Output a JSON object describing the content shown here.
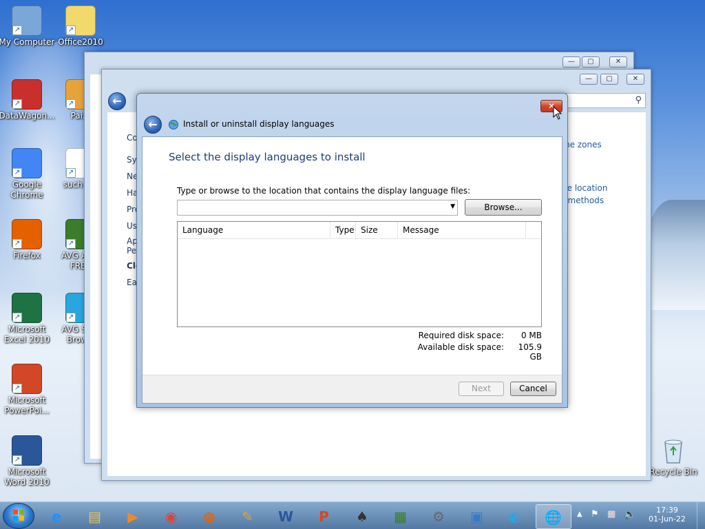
{
  "desktop": {
    "icons_col1": [
      {
        "label": "My Computer",
        "icon": "computer-icon",
        "color": "#7aa7d8"
      },
      {
        "label": "DataWagon...",
        "icon": "datawagon-icon",
        "color": "#c9302c"
      },
      {
        "label": "Google Chrome",
        "icon": "chrome-icon",
        "color": "#4285f4"
      },
      {
        "label": "Firefox",
        "icon": "firefox-icon",
        "color": "#e66000"
      },
      {
        "label": "Microsoft Excel 2010",
        "icon": "excel-icon",
        "color": "#1f7244"
      },
      {
        "label": "Microsoft PowerPoi...",
        "icon": "powerpoint-icon",
        "color": "#d24726"
      },
      {
        "label": "Microsoft Word 2010",
        "icon": "word-icon",
        "color": "#2b579a"
      }
    ],
    "icons_col2": [
      {
        "label": "Office2010",
        "icon": "iso-file-icon",
        "color": "#f2d96b"
      },
      {
        "label": "Pai...",
        "icon": "paint-icon",
        "color": "#e8a23a"
      },
      {
        "label": "such a...",
        "icon": "document-icon",
        "color": "#ffffff"
      },
      {
        "label": "AVG An... FREE",
        "icon": "avg-antivirus-icon",
        "color": "#3a7d2c"
      },
      {
        "label": "AVG Se... Brow...",
        "icon": "avg-browser-icon",
        "color": "#2aa6de"
      }
    ],
    "recycle_bin": {
      "label": "Recycle Bin",
      "icon": "recycle-bin-icon"
    }
  },
  "background_window": {
    "left_items": [
      "Co",
      "Sys",
      "Ne",
      "Ha",
      "Pro",
      "Us",
      "Ap",
      "Pe",
      "Clo",
      "Eas"
    ],
    "links": [
      "me zones",
      "ge location",
      "t methods"
    ]
  },
  "dialog": {
    "title": "Install or uninstall display languages",
    "heading": "Select the display languages to install",
    "path_label": "Type or browse to the location that contains the display language files:",
    "path_value": "",
    "browse_label": "Browse...",
    "columns": [
      "Language",
      "Type",
      "Size",
      "Message"
    ],
    "required_label": "Required disk space:",
    "required_value": "0 MB",
    "available_label": "Available disk space:",
    "available_value": "105.9 GB",
    "next_label": "Next",
    "cancel_label": "Cancel",
    "close_glyph": "✕"
  },
  "taskbar": {
    "apps": [
      {
        "icon": "internet-explorer-icon",
        "glyph": "e",
        "color": "#1e90ff"
      },
      {
        "icon": "file-explorer-icon",
        "glyph": "▤",
        "color": "#e8c35a"
      },
      {
        "icon": "media-player-icon",
        "glyph": "▶",
        "color": "#f08a24"
      },
      {
        "icon": "chrome-icon",
        "glyph": "◉",
        "color": "#db4437"
      },
      {
        "icon": "firefox-icon",
        "glyph": "◍",
        "color": "#e66000"
      },
      {
        "icon": "paint-icon",
        "glyph": "✎",
        "color": "#d9a441"
      },
      {
        "icon": "word-icon",
        "glyph": "W",
        "color": "#2b579a"
      },
      {
        "icon": "powerpoint-icon",
        "glyph": "P",
        "color": "#d24726"
      },
      {
        "icon": "solitaire-icon",
        "glyph": "♠",
        "color": "#333333"
      },
      {
        "icon": "avg-antivirus-icon",
        "glyph": "▦",
        "color": "#3a7d2c"
      },
      {
        "icon": "settings-gear-icon",
        "glyph": "⚙",
        "color": "#666666"
      },
      {
        "icon": "control-panel-icon",
        "glyph": "▣",
        "color": "#3a78c8"
      },
      {
        "icon": "avg-browser-icon",
        "glyph": "◐",
        "color": "#2aa6de"
      },
      {
        "icon": "region-language-icon",
        "glyph": "🌐",
        "color": "#2a7fd4"
      }
    ],
    "clock_time": "17:39",
    "clock_date": "01-Jun-22"
  }
}
